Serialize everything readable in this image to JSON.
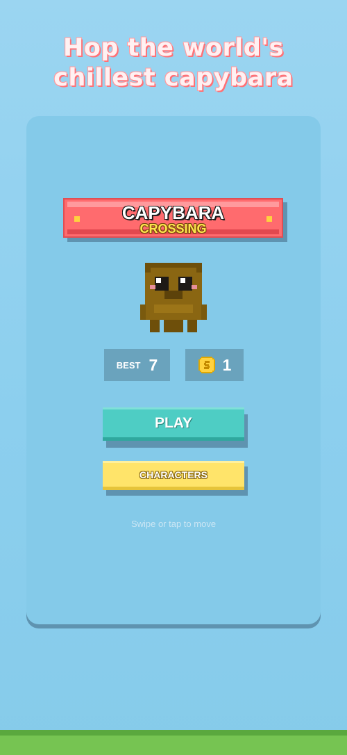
{
  "headline": {
    "line1": "Hop the world's",
    "line2": "chillest capybara"
  },
  "logo": {
    "title": "CAPYBARA",
    "subtitle": "CROSSING"
  },
  "character": {
    "icon": "capybara-pixel-icon"
  },
  "stats": {
    "best_label": "BEST",
    "best_value": "7",
    "coin_icon": "coin-icon",
    "coins_value": "1"
  },
  "buttons": {
    "play_label": "PLAY",
    "characters_label": "CHARACTERS"
  },
  "hint": "Swipe or tap to move",
  "colors": {
    "sky": "#9bd5f1",
    "card": "#84cae9",
    "banner": "#ff6b6e",
    "play": "#4ecdc4",
    "characters": "#ffe46a",
    "grass": "#76c452",
    "stat_box": "#6aa3bd"
  }
}
